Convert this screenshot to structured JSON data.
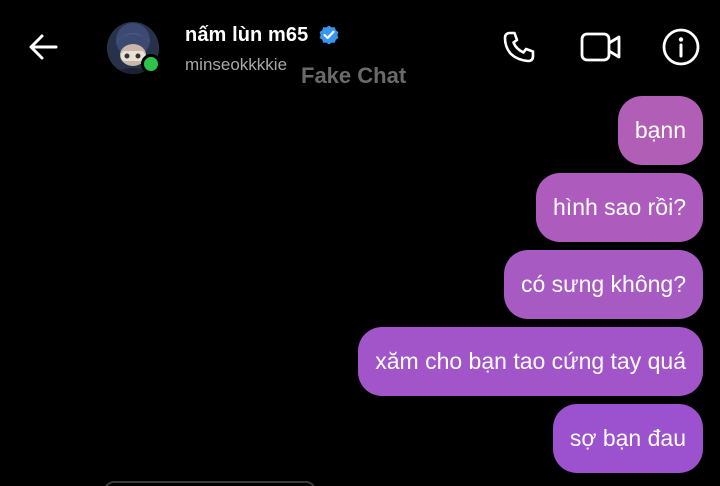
{
  "header": {
    "back_icon": "arrow-left-icon",
    "contact_name": "nấm lùn m65",
    "verified_icon": "verified-badge-icon",
    "username": "minseokkkkie",
    "online_color": "#2ec24b",
    "verified_color": "#3797f0",
    "actions": [
      {
        "name": "phone-icon"
      },
      {
        "name": "video-camera-icon"
      },
      {
        "name": "info-icon"
      }
    ]
  },
  "watermark": "Fake Chat",
  "messages": [
    {
      "text": "bạnn",
      "sender": "me"
    },
    {
      "text": "hình sao rồi?",
      "sender": "me"
    },
    {
      "text": "có sưng không?",
      "sender": "me"
    },
    {
      "text": "xăm cho bạn tao cứng tay quá",
      "sender": "me"
    },
    {
      "text": "sợ bạn đau",
      "sender": "me"
    }
  ],
  "colors": {
    "background": "#000000",
    "bubble_top": "#b060b8",
    "bubble_bottom": "#9a4fd0",
    "username": "#a8a8a8"
  }
}
